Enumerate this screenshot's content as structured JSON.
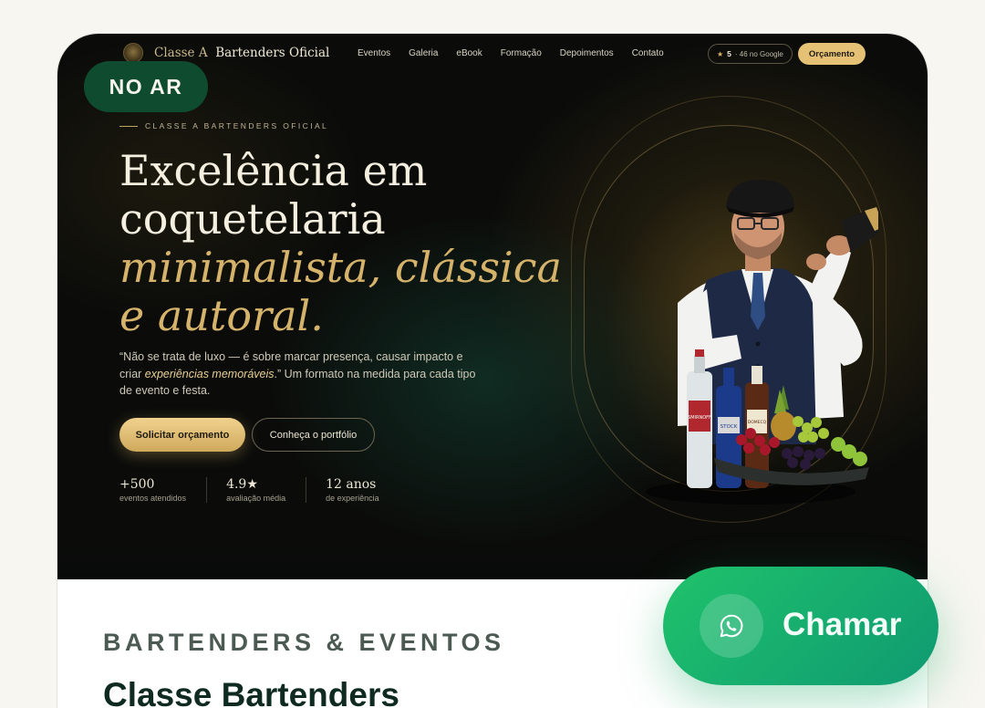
{
  "nav": {
    "brand_prefix": "Classe A",
    "brand_name": "Bartenders Oficial",
    "links": [
      "Eventos",
      "Galeria",
      "eBook",
      "Formação",
      "Depoimentos",
      "Contato"
    ],
    "rating_value": "5",
    "rating_text": "· 46 no Google",
    "cta_label": "Orçamento"
  },
  "badge": {
    "live_label": "NO AR"
  },
  "hero": {
    "kicker": "CLASSE A BARTENDERS OFICIAL",
    "title_line1": "Excelência em",
    "title_line2": "coquetelaria",
    "title_line3": "minimalista, clássica",
    "title_line4": "e autoral.",
    "lead_part1": "“Não se trata de luxo — é sobre marcar presença, causar impacto e criar ",
    "lead_em": "experiências memoráveis",
    "lead_part2": ".” Um formato na medida para cada tipo de evento e festa.",
    "primary_button": "Solicitar orçamento",
    "secondary_button": "Conheça o portfólio",
    "stats": [
      {
        "value": "+500",
        "label": "eventos atendidos"
      },
      {
        "value": "4.9★",
        "label": "avaliação média"
      },
      {
        "value": "12 anos",
        "label": "de experiência"
      }
    ],
    "bottle_labels": [
      "SMIRNOFF",
      "STOCK",
      "DOMECQ"
    ]
  },
  "section": {
    "kicker": "BARTENDERS & EVENTOS",
    "title": "Classe Bartenders"
  },
  "whatsapp": {
    "label": "Chamar",
    "icon": "whatsapp-icon"
  },
  "colors": {
    "gold": "#d6b36b",
    "dark": "#0b0c0a",
    "green_badge": "#0f4b2f",
    "whatsapp": "#1fc26b"
  }
}
